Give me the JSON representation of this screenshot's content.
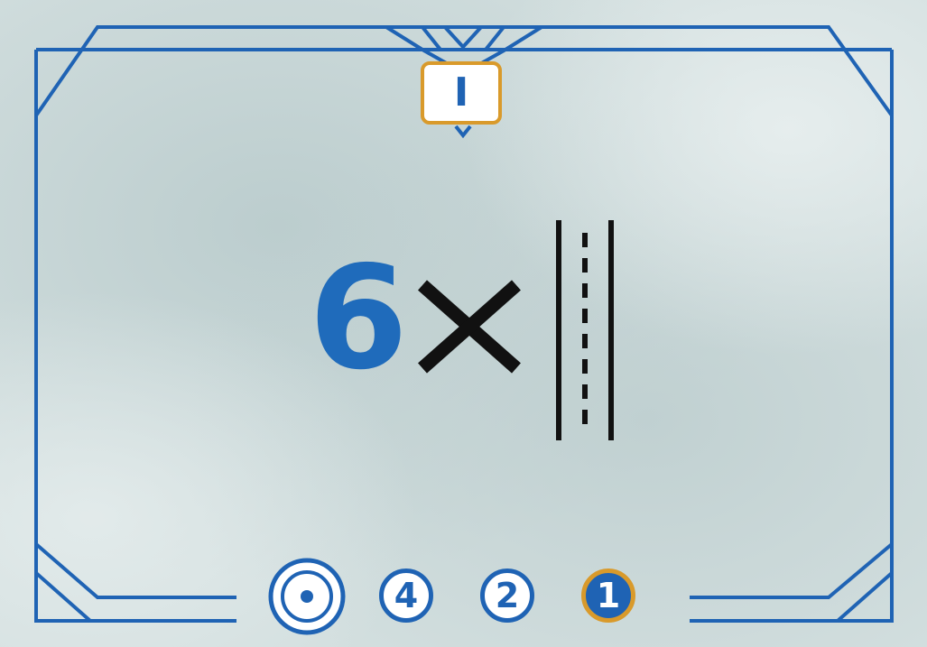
{
  "card": {
    "level": "I",
    "count": "6",
    "multiply_symbol": "×",
    "road_icon": "road-straight-icon",
    "target_icon": "bullseye-icon",
    "scores": [
      "4",
      "2",
      "1"
    ],
    "highlighted_score": "1"
  },
  "colors": {
    "frame_blue": "#1f63b4",
    "accent_orange": "#d99a2b",
    "background": "#cfdcdc"
  }
}
